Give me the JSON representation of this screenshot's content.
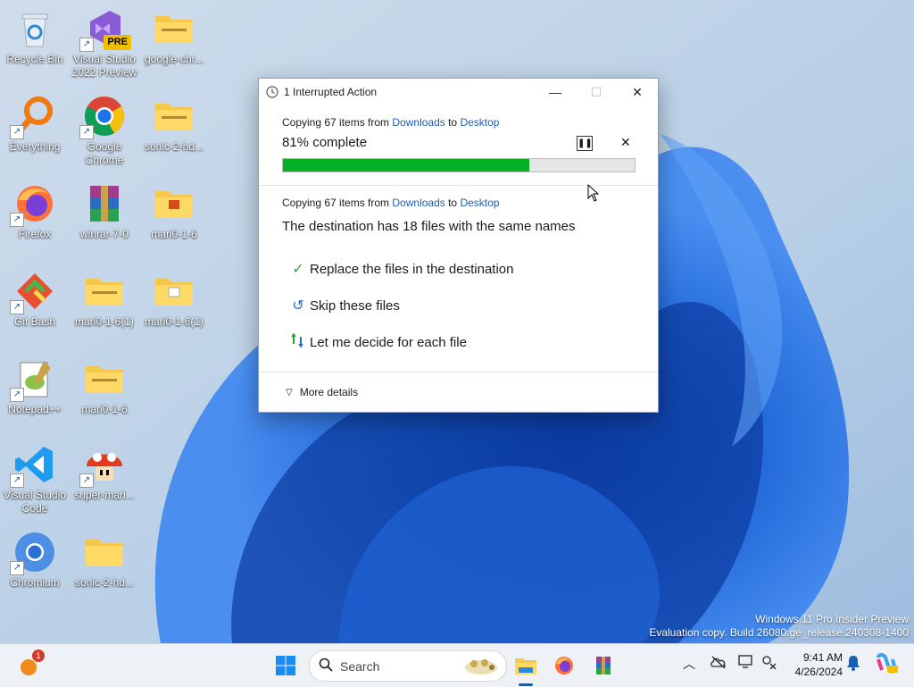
{
  "desktop_icons": [
    {
      "id": "recycle-bin",
      "label": "Recycle Bin"
    },
    {
      "id": "vs-preview",
      "label": "Visual Studio 2022 Preview",
      "badge": "PRE"
    },
    {
      "id": "google-chr-folder",
      "label": "google-chr..."
    },
    {
      "id": "everything",
      "label": "Everything"
    },
    {
      "id": "google-chrome",
      "label": "Google Chrome"
    },
    {
      "id": "sonic-folder-1",
      "label": "sonic-2-hd..."
    },
    {
      "id": "firefox",
      "label": "Firefox"
    },
    {
      "id": "winrar",
      "label": "winrar-7-0"
    },
    {
      "id": "mari0-folder-1",
      "label": "mari0-1-6"
    },
    {
      "id": "git-bash",
      "label": "Git Bash"
    },
    {
      "id": "mari0-zip-1",
      "label": "mari0-1-6(1)"
    },
    {
      "id": "mari0-folder-2",
      "label": "mari0-1-6(1)"
    },
    {
      "id": "notepadpp",
      "label": "Notepad++"
    },
    {
      "id": "mari0-zip-2",
      "label": "mari0-1-6"
    },
    {
      "id": "vscode",
      "label": "Visual Studio Code"
    },
    {
      "id": "super-mario",
      "label": "super-mari..."
    },
    {
      "id": "chromium",
      "label": "Chromium"
    },
    {
      "id": "sonic-folder-2",
      "label": "sonic-2-hd..."
    }
  ],
  "dialog": {
    "title": "1 Interrupted Action",
    "copy1_prefix": "Copying 67 items from ",
    "copy1_from": "Downloads",
    "copy1_mid": " to ",
    "copy1_to": "Desktop",
    "percent_label": "81% complete",
    "progress": 0.7,
    "copy2_prefix": "Copying 67 items from ",
    "copy2_from": "Downloads",
    "copy2_mid": " to ",
    "copy2_to": "Desktop",
    "headline": "The destination has 18 files with the same names",
    "options": [
      {
        "label": "Replace the files in the destination",
        "icon": "checkmark-icon"
      },
      {
        "label": "Skip these files",
        "icon": "undo-icon"
      },
      {
        "label": "Let me decide for each file",
        "icon": "compare-icon"
      }
    ],
    "more_details": "More details"
  },
  "watermark": {
    "line1": "Windows 11 Pro Insider Preview",
    "line2": "Evaluation copy. Build 26080.ge_release.240308-1400"
  },
  "taskbar": {
    "notification_count": "1",
    "search_placeholder": "Search",
    "time": "9:41 AM",
    "date": "4/26/2024"
  },
  "colors": {
    "accent": "#1a5fb4",
    "progress_fill": "#06b025",
    "taskbar_bg": "#eef2f7"
  }
}
